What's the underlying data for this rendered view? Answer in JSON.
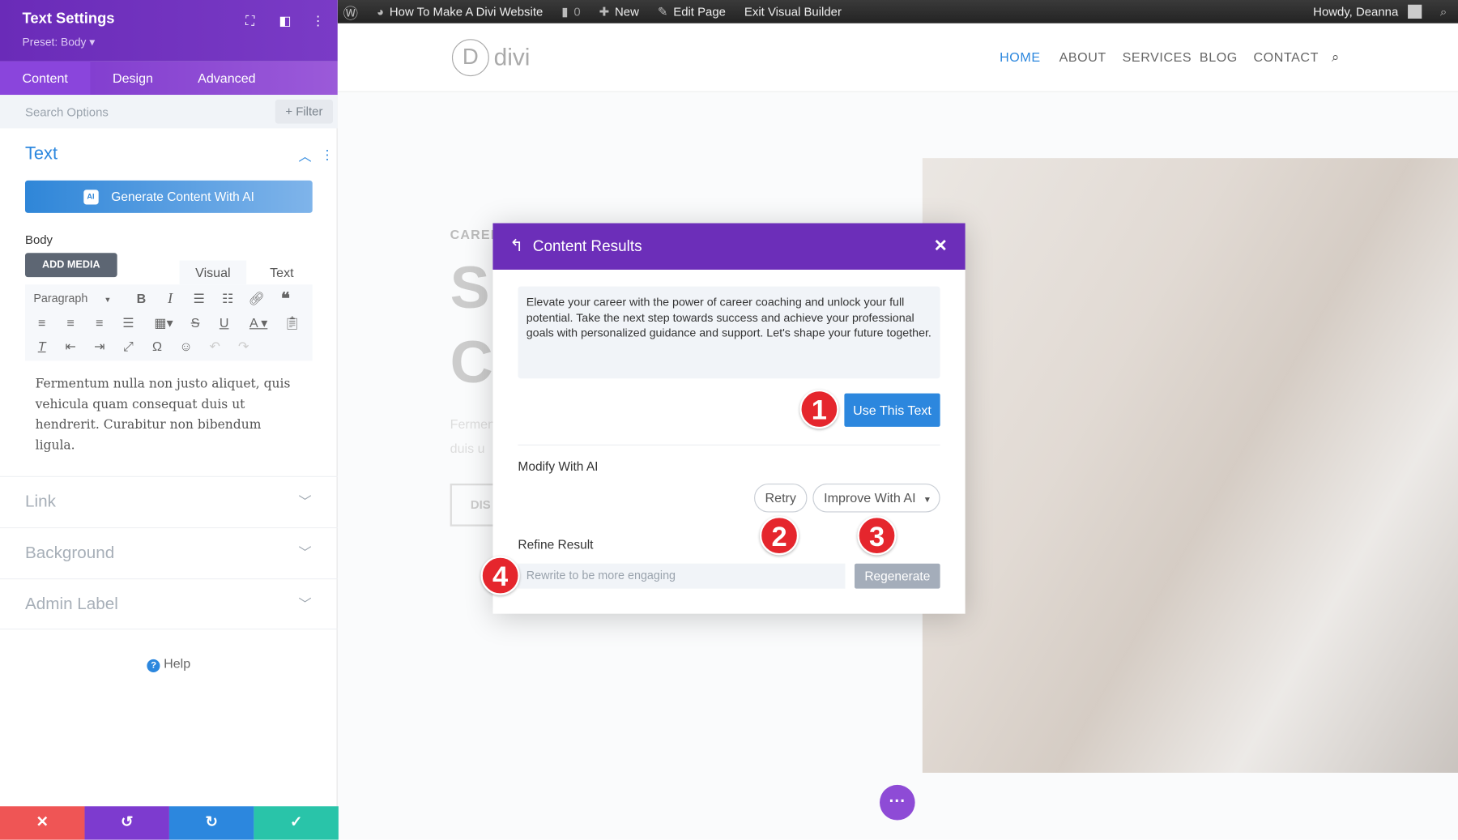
{
  "admin_bar": {
    "site": "How To Make A Divi Website",
    "comments": "0",
    "new": "New",
    "edit": "Edit Page",
    "exit": "Exit Visual Builder",
    "howdy": "Howdy, Deanna"
  },
  "panel": {
    "title": "Text Settings",
    "preset": "Preset: Body ▾",
    "tabs": [
      "Content",
      "Design",
      "Advanced"
    ],
    "search_placeholder": "Search Options",
    "filter": "+ Filter",
    "section": "Text",
    "generate": "Generate Content With AI",
    "ai_badge": "AI",
    "body_label": "Body",
    "add_media": "ADD MEDIA",
    "editor_tabs": [
      "Visual",
      "Text"
    ],
    "paragraph": "Paragraph",
    "body_text": "Fermentum nulla non justo aliquet, quis vehicula quam consequat duis ut hendrerit. Curabitur non bibendum ligula.",
    "accordions": [
      "Link",
      "Background",
      "Admin Label"
    ],
    "help": "Help"
  },
  "site": {
    "logo": "divi",
    "nav": [
      "HOME",
      "ABOUT",
      "SERVICES",
      "BLOG",
      "CONTACT"
    ],
    "active_nav": "HOME",
    "bg_label": "CAREE",
    "bg_big1": "S",
    "bg_big2": "C",
    "bg_text1": "Fermen",
    "bg_text2": "duis u",
    "bg_btn": "DIS"
  },
  "modal": {
    "title": "Content Results",
    "result": "Elevate your career with the power of career coaching and unlock your full potential. Take the next step towards success and achieve your professional goals with personalized guidance and support. Let's shape your future together.",
    "use": "Use This Text",
    "modify": "Modify With AI",
    "retry": "Retry",
    "improve": "Improve With AI",
    "refine": "Refine Result",
    "refine_placeholder": "Rewrite to be more engaging",
    "regenerate": "Regenerate"
  },
  "markers": [
    "1",
    "2",
    "3",
    "4"
  ],
  "colors": {
    "purple": "#6c2eb9",
    "blue": "#2c87de",
    "red": "#e5262d",
    "green": "#29c4a9"
  }
}
